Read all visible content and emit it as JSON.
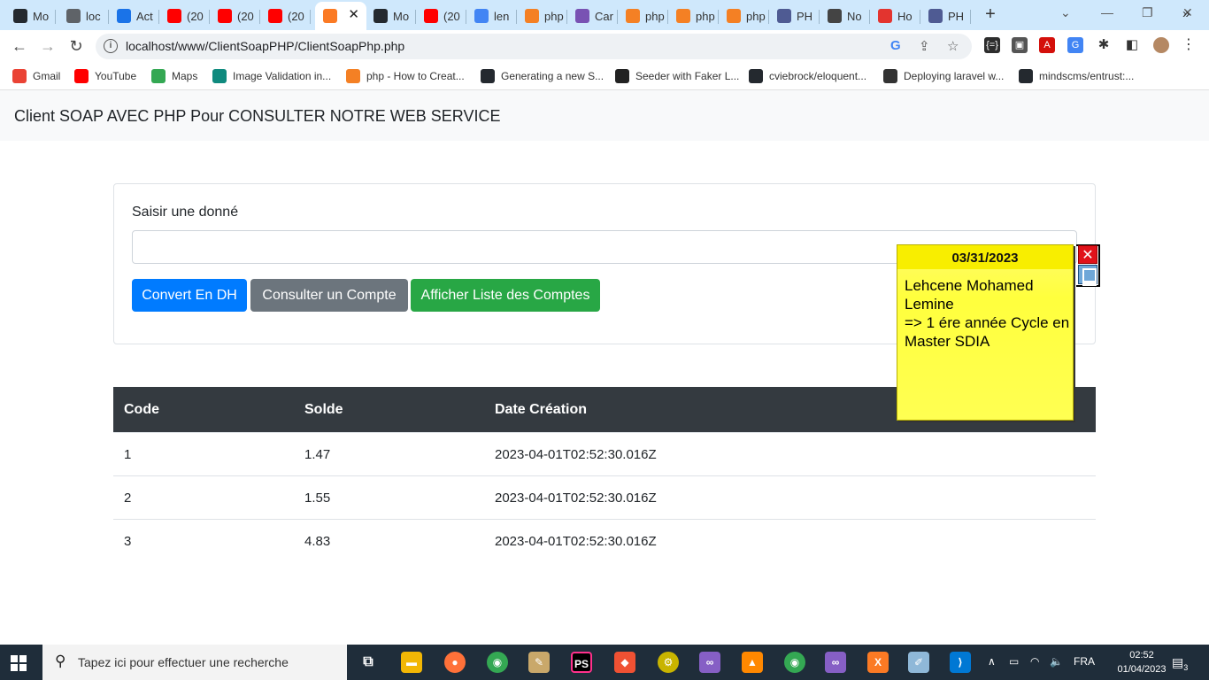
{
  "browser": {
    "tabs": [
      {
        "label": "Mo",
        "icon": "github-icon",
        "color": "#24292f"
      },
      {
        "label": "loc",
        "icon": "globe-icon",
        "color": "#5f6368"
      },
      {
        "label": "Act",
        "icon": "contacts-icon",
        "color": "#1a73e8"
      },
      {
        "label": "(20",
        "icon": "youtube-icon",
        "color": "#ff0000"
      },
      {
        "label": "(20",
        "icon": "youtube-icon",
        "color": "#ff0000"
      },
      {
        "label": "(20",
        "icon": "youtube-icon",
        "color": "#ff0000"
      },
      {
        "label": "",
        "icon": "xampp-icon",
        "color": "#fb7a24",
        "active": true
      },
      {
        "label": "Mo",
        "icon": "github-icon",
        "color": "#24292f"
      },
      {
        "label": "(20",
        "icon": "youtube-icon",
        "color": "#ff0000"
      },
      {
        "label": "len",
        "icon": "google-icon",
        "color": "#4285f4"
      },
      {
        "label": "php",
        "icon": "stackoverflow-icon",
        "color": "#f48024"
      },
      {
        "label": "Car",
        "icon": "bootstrap-icon",
        "color": "#7952b3"
      },
      {
        "label": "php",
        "icon": "stackoverflow-icon",
        "color": "#f48024"
      },
      {
        "label": "php",
        "icon": "stackoverflow-icon",
        "color": "#f48024"
      },
      {
        "label": "php",
        "icon": "stackoverflow-icon",
        "color": "#f48024"
      },
      {
        "label": "PH",
        "icon": "php-icon",
        "color": "#4f5b93"
      },
      {
        "label": "No",
        "icon": "chromium-icon",
        "color": "#444"
      },
      {
        "label": "Ho",
        "icon": "laravel-icon",
        "color": "#e3342f"
      },
      {
        "label": "PH",
        "icon": "php-icon",
        "color": "#4f5b93"
      }
    ],
    "active_tab_close": "✕",
    "new_tab": "+",
    "url": "localhost/www/ClientSoapPHP/ClientSoapPhp.php",
    "bookmarks": [
      {
        "label": "Gmail",
        "icon": "gmail-icon",
        "color": "#ea4335"
      },
      {
        "label": "YouTube",
        "icon": "youtube-icon",
        "color": "#ff0000"
      },
      {
        "label": "Maps",
        "icon": "maps-icon",
        "color": "#34a853"
      },
      {
        "label": "Image Validation in...",
        "icon": "ns-icon",
        "color": "#0f8a7e"
      },
      {
        "label": "php - How to Creat...",
        "icon": "stackoverflow-icon",
        "color": "#f48024"
      },
      {
        "label": "Generating a new S...",
        "icon": "github-icon",
        "color": "#24292f"
      },
      {
        "label": "Seeder with Faker L...",
        "icon": "dark-circle-icon",
        "color": "#222"
      },
      {
        "label": "cviebrock/eloquent...",
        "icon": "github-icon",
        "color": "#24292f"
      },
      {
        "label": "Deploying laravel w...",
        "icon": "send-icon",
        "color": "#333"
      },
      {
        "label": "mindscms/entrust:...",
        "icon": "github-icon",
        "color": "#24292f"
      }
    ],
    "more_bookmarks": "»"
  },
  "app": {
    "brand": "Client SOAP AVEC PHP Pour CONSULTER NOTRE WEB SERVICE",
    "form": {
      "label": "Saisir une donné",
      "input_value": "",
      "buttons": [
        {
          "label": "Convert En DH",
          "color": "#007bff"
        },
        {
          "label": "Consulter un Compte",
          "color": "#6c757d"
        },
        {
          "label": "Afficher Liste des Comptes",
          "color": "#28a745"
        }
      ]
    },
    "table": {
      "headers": [
        "Code",
        "Solde",
        "Date Création"
      ],
      "rows": [
        [
          "1",
          "1.47",
          "2023-04-01T02:52:30.016Z"
        ],
        [
          "2",
          "1.55",
          "2023-04-01T02:52:30.016Z"
        ],
        [
          "3",
          "4.83",
          "2023-04-01T02:52:30.016Z"
        ]
      ]
    }
  },
  "sticky_note": {
    "date": "03/31/2023",
    "text": "Lehcene Mohamed Lemine\n=> 1 ére année Cycle en Master SDIA",
    "close": "✕"
  },
  "taskbar": {
    "search_placeholder": "Tapez ici pour effectuer une recherche",
    "language": "FRA",
    "time": "02:52",
    "date": "01/04/2023",
    "notifications": "3"
  }
}
